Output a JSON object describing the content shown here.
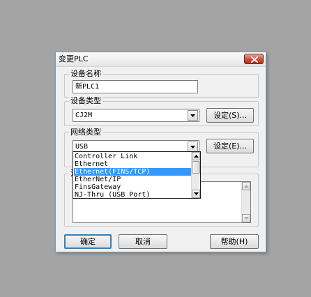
{
  "dialog": {
    "title": "变更PLC"
  },
  "device_name": {
    "label": "设备名称",
    "value": "新PLC1"
  },
  "device_type": {
    "label": "设备类型",
    "value": "CJ2M",
    "settings_button": "设定(S)..."
  },
  "network_type": {
    "label": "网络类型",
    "value": "USB",
    "settings_button": "设定(E)...",
    "options": [
      "Controller Link",
      "Ethernet",
      "Ethernet(FINS/TCP)",
      "EtherNet/IP",
      "FinsGateway",
      "NJ-Thru (USB Port)"
    ],
    "selected_index": 2
  },
  "comment": {
    "label": "注",
    "value": ""
  },
  "buttons": {
    "ok": "确定",
    "cancel": "取消",
    "help": "帮助(H)"
  },
  "colors": {
    "desktop": "#a4a4a4",
    "selection": "#3399ff",
    "close_button": "#c7503a"
  }
}
